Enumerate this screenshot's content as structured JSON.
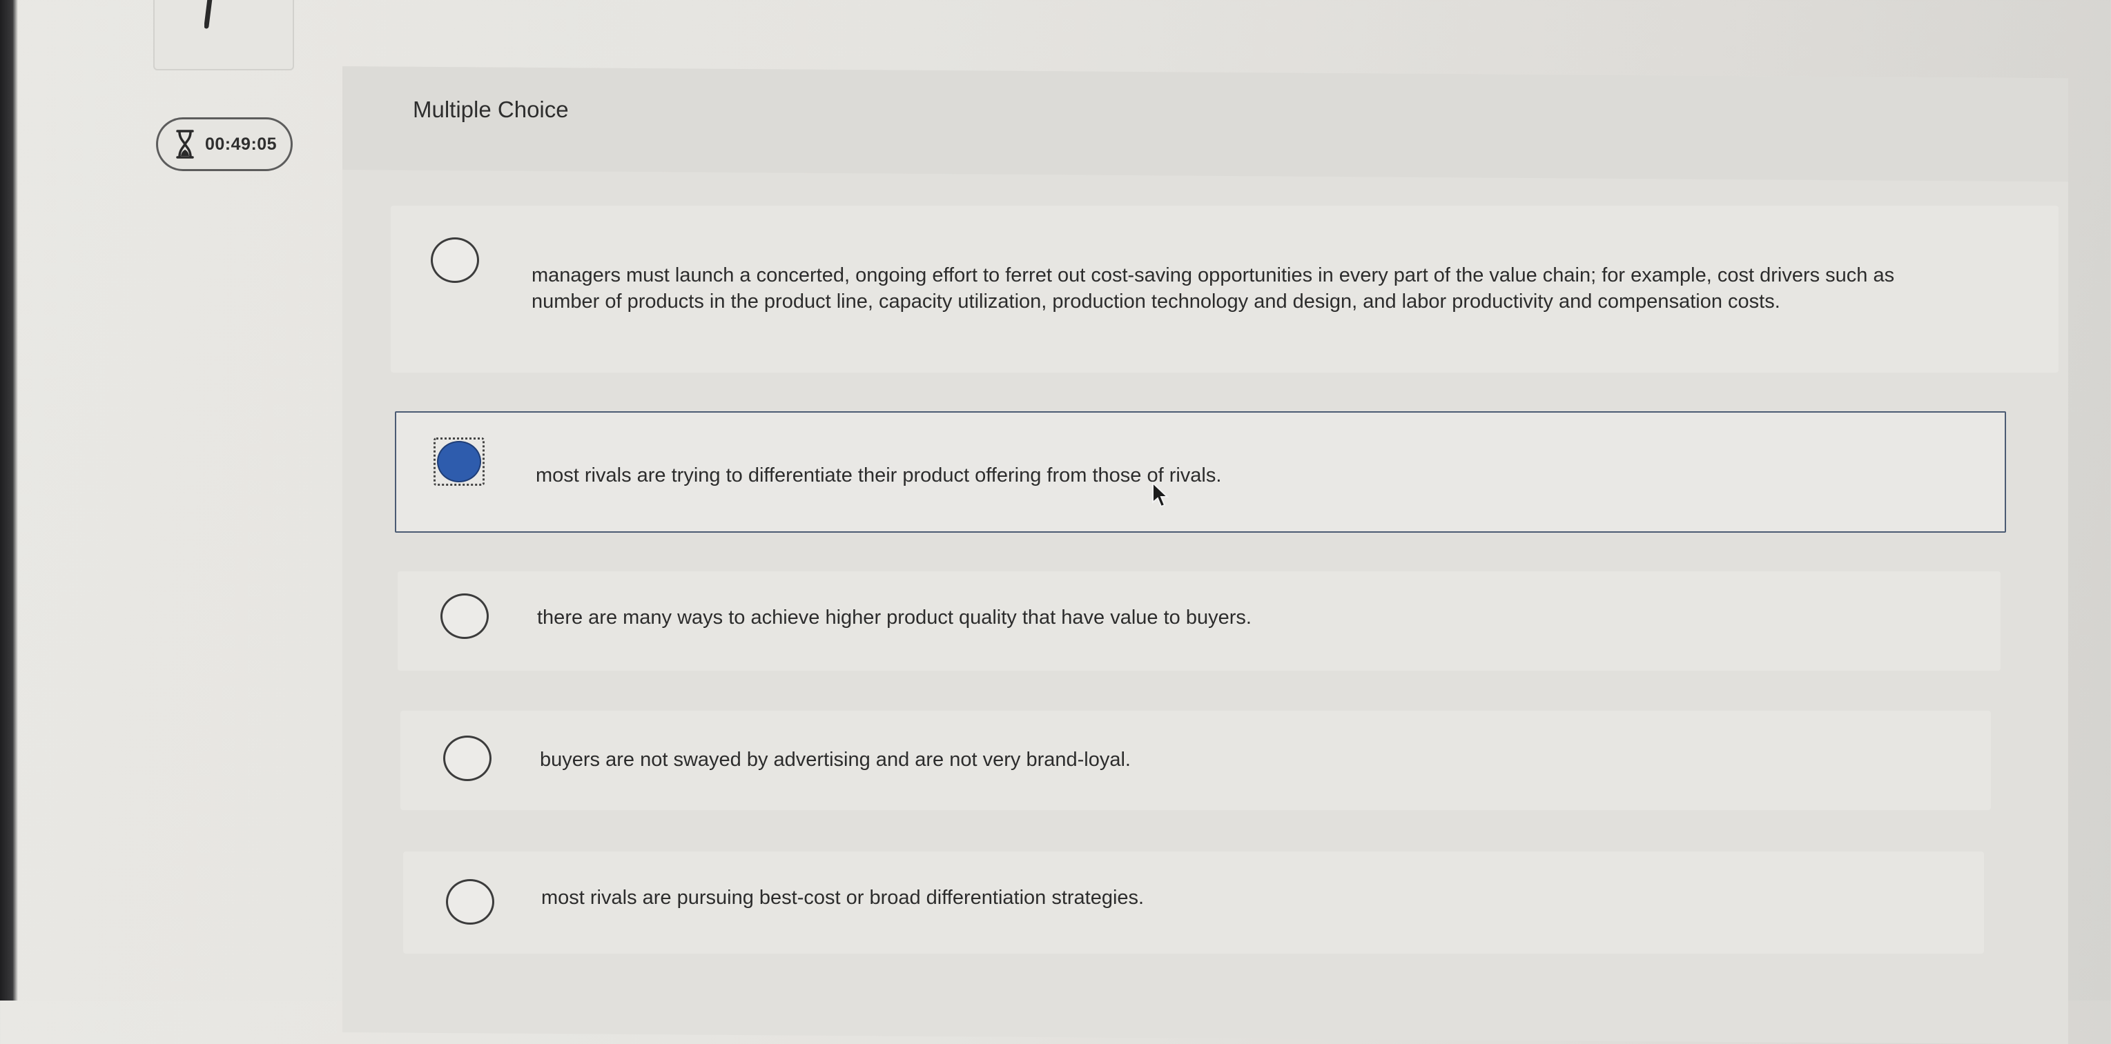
{
  "timer": {
    "value": "00:49:05",
    "icon": "hourglass-icon"
  },
  "question": {
    "type_label": "Multiple Choice"
  },
  "options": [
    {
      "text": "managers must launch a concerted, ongoing effort to ferret out cost-saving opportunities in every part of the value chain; for example, cost drivers such as number of products in the product line, capacity utilization, production technology and design, and labor productivity and compensation costs.",
      "selected": false
    },
    {
      "text": "most rivals are trying to differentiate their product offering from those of rivals.",
      "selected": true
    },
    {
      "text": "there are many ways to achieve higher product quality that have value to buyers.",
      "selected": false
    },
    {
      "text": "buyers are not swayed by advertising and are not very brand-loyal.",
      "selected": false
    },
    {
      "text": "most rivals are pursuing best-cost or broad differentiation strategies.",
      "selected": false
    }
  ],
  "colors": {
    "selected_radio": "#2e5cad",
    "selected_border": "#4b5b73"
  }
}
